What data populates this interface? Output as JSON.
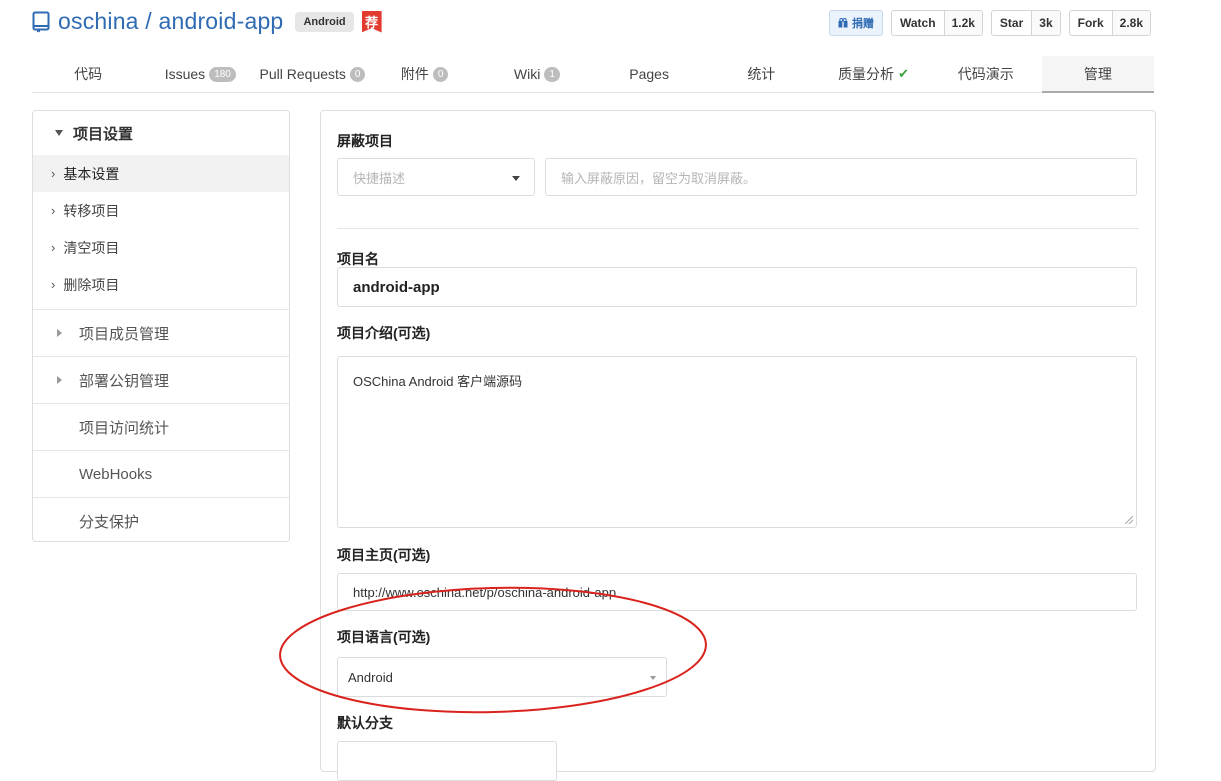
{
  "header": {
    "owner": "oschina",
    "separator": " / ",
    "repo": "android-app",
    "language_badge": "Android",
    "recommend_badge": "荐",
    "actions": {
      "donate": {
        "label": "捐赠"
      },
      "watch": {
        "label": "Watch",
        "count": "1.2k"
      },
      "star": {
        "label": "Star",
        "count": "3k"
      },
      "fork": {
        "label": "Fork",
        "count": "2.8k"
      }
    }
  },
  "tabs": [
    {
      "label": "代码"
    },
    {
      "label": "Issues",
      "count": "180"
    },
    {
      "label": "Pull Requests",
      "count": "0"
    },
    {
      "label": "附件",
      "count": "0"
    },
    {
      "label": "Wiki",
      "count": "1"
    },
    {
      "label": "Pages"
    },
    {
      "label": "统计"
    },
    {
      "label": "质量分析",
      "check": "✔"
    },
    {
      "label": "代码演示"
    },
    {
      "label": "管理"
    }
  ],
  "sidebar": {
    "section_title": "项目设置",
    "sub_items": [
      "基本设置",
      "转移项目",
      "清空项目",
      "删除项目"
    ],
    "sections": [
      "项目成员管理",
      "部署公钥管理",
      "项目访问统计",
      "WebHooks",
      "分支保护"
    ]
  },
  "form": {
    "block_label": "屏蔽项目",
    "block_select_placeholder": "快捷描述",
    "block_reason_placeholder": "输入屏蔽原因，留空为取消屏蔽。",
    "name_label": "项目名",
    "name_value": "android-app",
    "desc_label": "项目介绍(可选)",
    "desc_value": "OSChina Android 客户端源码",
    "homepage_label": "项目主页(可选)",
    "homepage_value": "http://www.oschina.net/p/oschina-android-app",
    "lang_label": "项目语言(可选)",
    "lang_value": "Android",
    "branch_label": "默认分支"
  },
  "colors": {
    "link_blue": "#2f6bb3",
    "annotation_red": "#d9231d"
  }
}
